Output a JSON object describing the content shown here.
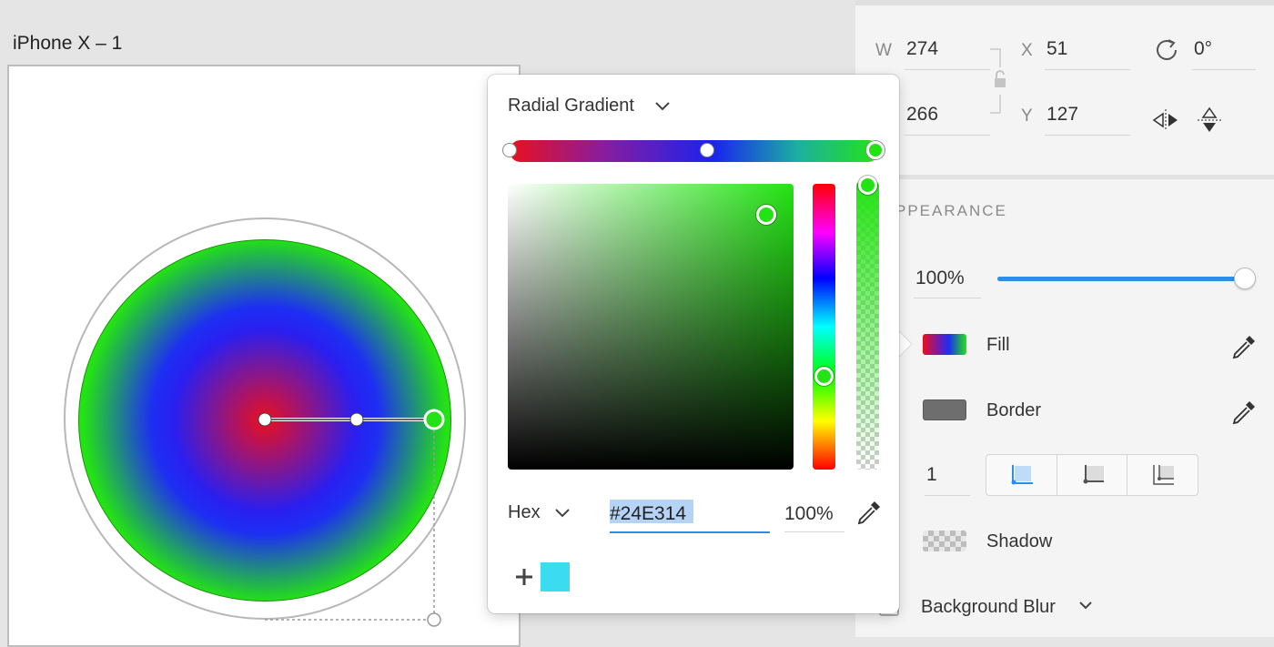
{
  "canvas": {
    "artboard_title": "iPhone X – 1"
  },
  "color_picker": {
    "fill_type": "Radial Gradient",
    "color_mode": "Hex",
    "hex_value": "#24E314",
    "opacity": "100%",
    "gradient_colors": [
      "#E8101E",
      "#1D2FF2",
      "#24E314"
    ],
    "swatches": [
      {
        "color": "#3CDCF0"
      }
    ]
  },
  "inspector": {
    "w_label": "W",
    "w_value": "274",
    "h_value": "266",
    "x_label": "X",
    "x_value": "51",
    "y_label": "Y",
    "y_value": "127",
    "rotation": "0°",
    "appearance_title": "PPEARANCE",
    "opacity_value": "100%",
    "opacity_fraction": 1.0,
    "fill_label": "Fill",
    "border_label": "Border",
    "border_color": "#6E6E6E",
    "border_width": "1",
    "shadow_label": "Shadow",
    "background_blur_label": "Background Blur"
  },
  "colors": {
    "accent": "#2B8EE8",
    "selected_stop": "#24E314"
  }
}
